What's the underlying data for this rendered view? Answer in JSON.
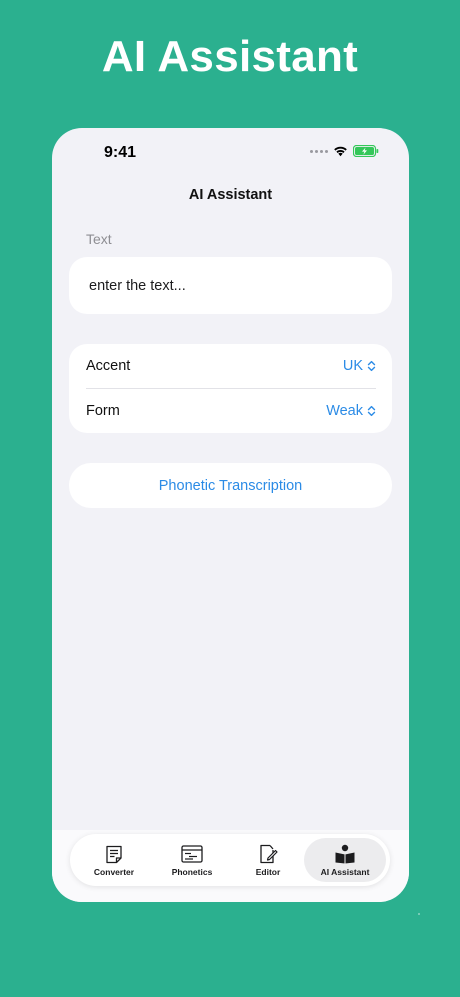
{
  "promo": {
    "title": "AI Assistant"
  },
  "status_bar": {
    "time": "9:41",
    "icons": [
      "signal-dots-icon",
      "wifi-icon",
      "battery-charging-icon"
    ]
  },
  "nav": {
    "title": "AI Assistant"
  },
  "text_section": {
    "label": "Text",
    "input_value": "",
    "input_placeholder": "enter the text..."
  },
  "options": {
    "accent": {
      "label": "Accent",
      "value": "UK",
      "icon": "chevron-updown-icon"
    },
    "form": {
      "label": "Form",
      "value": "Weak",
      "icon": "chevron-updown-icon"
    }
  },
  "action": {
    "label": "Phonetic Transcription"
  },
  "tab_bar": {
    "items": [
      {
        "label": "Converter",
        "icon": "document-icon",
        "active": false
      },
      {
        "label": "Phonetics",
        "icon": "phonetics-icon",
        "active": false
      },
      {
        "label": "Editor",
        "icon": "edit-icon",
        "active": false
      },
      {
        "label": "AI Assistant",
        "icon": "reader-book-icon",
        "active": true
      }
    ]
  },
  "colors": {
    "background": "#2bb08f",
    "accent": "#2b8be6",
    "screen": "#f2f2f7",
    "battery": "#34c759"
  }
}
